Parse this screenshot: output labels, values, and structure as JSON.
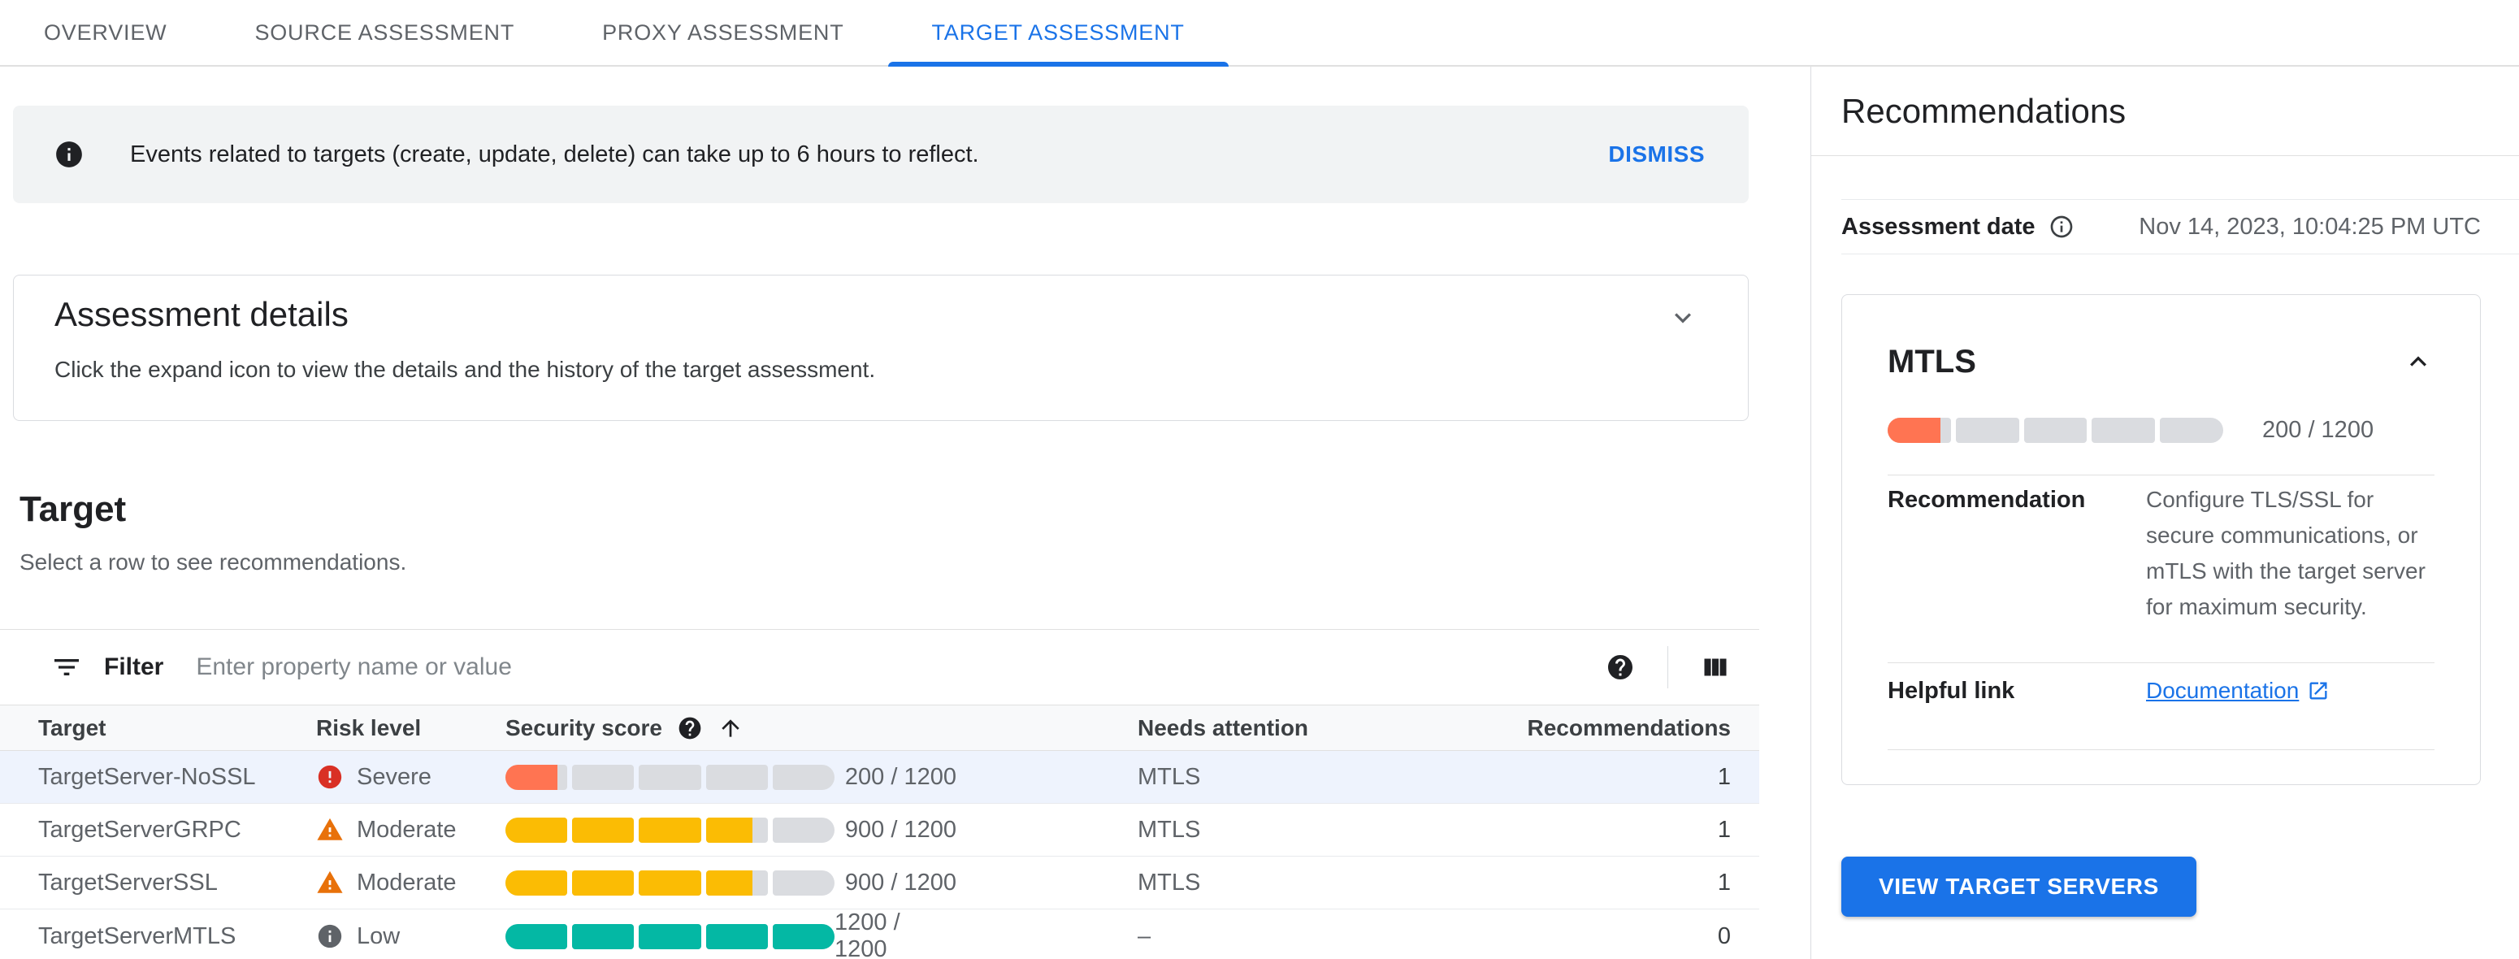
{
  "tabs": [
    {
      "label": "OVERVIEW",
      "active": false
    },
    {
      "label": "SOURCE ASSESSMENT",
      "active": false
    },
    {
      "label": "PROXY ASSESSMENT",
      "active": false
    },
    {
      "label": "TARGET ASSESSMENT",
      "active": true
    }
  ],
  "banner": {
    "text": "Events related to targets (create, update, delete) can take up to 6 hours to reflect.",
    "dismiss_label": "DISMISS"
  },
  "assessment_details": {
    "title": "Assessment details",
    "subtitle": "Click the expand icon to view the details and the history of the target assessment."
  },
  "target_section": {
    "title": "Target",
    "subtitle": "Select a row to see recommendations."
  },
  "filter": {
    "label": "Filter",
    "placeholder": "Enter property name or value"
  },
  "table": {
    "columns": {
      "target": "Target",
      "risk": "Risk level",
      "score": "Security score",
      "needs": "Needs attention",
      "recs": "Recommendations"
    },
    "score_max": 1200,
    "segments": 5,
    "rows": [
      {
        "target": "TargetServer-NoSSL",
        "risk": "Severe",
        "risk_level": "severe",
        "score": 200,
        "score_label": "200 / 1200",
        "needs_attention": "MTLS",
        "recommendations": "1",
        "selected": true
      },
      {
        "target": "TargetServerGRPC",
        "risk": "Moderate",
        "risk_level": "moderate",
        "score": 900,
        "score_label": "900 / 1200",
        "needs_attention": "MTLS",
        "recommendations": "1",
        "selected": false
      },
      {
        "target": "TargetServerSSL",
        "risk": "Moderate",
        "risk_level": "moderate",
        "score": 900,
        "score_label": "900 / 1200",
        "needs_attention": "MTLS",
        "recommendations": "1",
        "selected": false
      },
      {
        "target": "TargetServerMTLS",
        "risk": "Low",
        "risk_level": "low",
        "score": 1200,
        "score_label": "1200 / 1200",
        "needs_attention": "–",
        "recommendations": "0",
        "selected": false
      }
    ]
  },
  "panel": {
    "title": "Recommendations",
    "assessment_date_label": "Assessment date",
    "assessment_date": "Nov 14, 2023, 10:04:25 PM UTC",
    "card": {
      "title": "MTLS",
      "score": 200,
      "score_label": "200 / 1200",
      "risk_level": "severe",
      "recommendation_label": "Recommendation",
      "recommendation": "Configure TLS/SSL for secure communications, or mTLS with the target server for maximum security.",
      "helpful_link_label": "Helpful link",
      "link_text": "Documentation"
    },
    "button_label": "VIEW TARGET SERVERS"
  },
  "colors": {
    "accent": "#1a73e8",
    "selected_row": "#eef3fd",
    "bar_track": "#dadce0",
    "risk": {
      "severe": "#d93025",
      "moderate": "#e8710a",
      "low": "#5f6368"
    },
    "bars": {
      "severe": "#ff7452",
      "moderate": "#fbbc04",
      "low": "#04b8a4"
    }
  }
}
